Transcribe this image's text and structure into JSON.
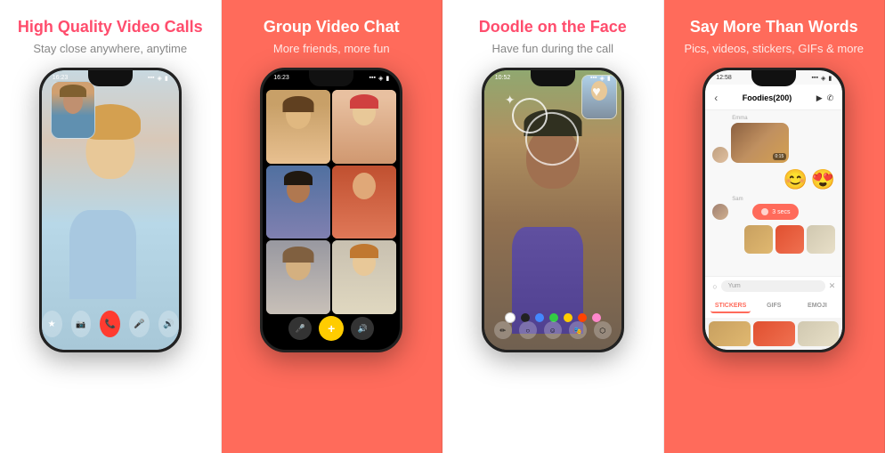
{
  "panels": [
    {
      "id": "panel-1",
      "title": "High Quality Video Calls",
      "subtitle": "Stay close anywhere, anytime",
      "theme": "white",
      "statusTime": "16:23",
      "controls": [
        "star",
        "camera",
        "mic",
        "end-call",
        "volume"
      ],
      "endCallColor": "#ff3b30"
    },
    {
      "id": "panel-2",
      "title": "Group Video Chat",
      "subtitle": "More friends, more fun",
      "theme": "coral",
      "statusTime": "16:23",
      "gridCells": 6,
      "addButtonLabel": "+"
    },
    {
      "id": "panel-3",
      "title": "Doodle on the Face",
      "subtitle": "Have fun during the call",
      "theme": "white",
      "statusTime": "10:52",
      "colors": [
        "white",
        "#333",
        "#4488ff",
        "#33cc44",
        "#ffcc00",
        "#ff4400",
        "#ff88cc"
      ],
      "tools": [
        "✏️",
        "⭕",
        "😊",
        "🎭",
        "🔗"
      ]
    },
    {
      "id": "panel-4",
      "title": "Say More Than Words",
      "subtitle": "Pics, videos, stickers, GIFs & more",
      "theme": "coral",
      "statusTime": "12:58",
      "chatTitle": "Foodies(200)",
      "messageSender": "Emma",
      "messageSelf": "Yum",
      "voiceMsg": "3 secs",
      "inputPlaceholder": "Yum",
      "tabs": [
        "STICKERS",
        "GIFS",
        "EMOJI"
      ]
    }
  ]
}
